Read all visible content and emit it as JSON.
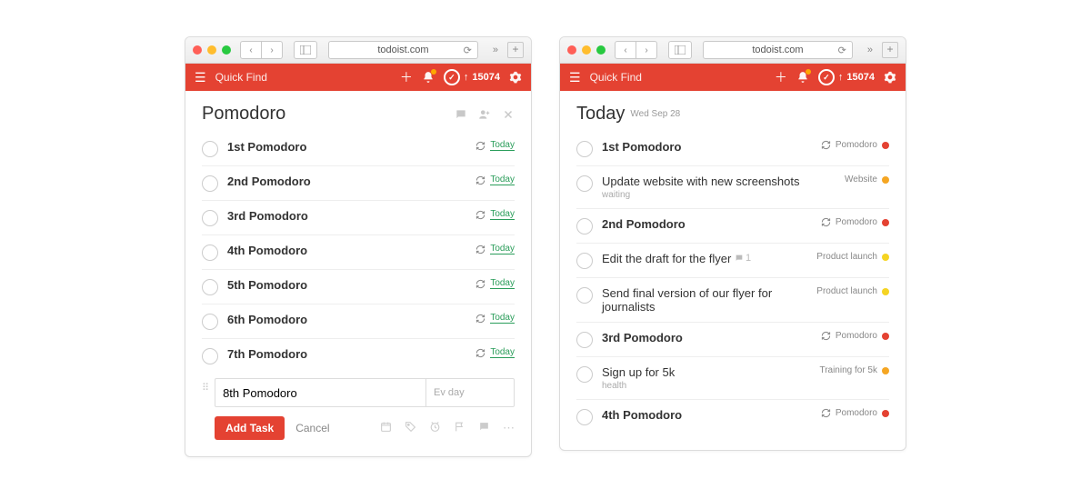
{
  "browser": {
    "url": "todoist.com"
  },
  "appbar": {
    "quick_find": "Quick Find",
    "karma_score": "15074"
  },
  "left": {
    "title": "Pomodoro",
    "tasks": [
      {
        "title": "1st Pomodoro",
        "tag": "Today",
        "recur": true
      },
      {
        "title": "2nd Pomodoro",
        "tag": "Today",
        "recur": true
      },
      {
        "title": "3rd Pomodoro",
        "tag": "Today",
        "recur": true
      },
      {
        "title": "4th Pomodoro",
        "tag": "Today",
        "recur": true
      },
      {
        "title": "5th Pomodoro",
        "tag": "Today",
        "recur": true
      },
      {
        "title": "6th Pomodoro",
        "tag": "Today",
        "recur": true
      },
      {
        "title": "7th Pomodoro",
        "tag": "Today",
        "recur": true
      }
    ],
    "new_task_value": "8th Pomodoro",
    "schedule_placeholder": "Ev day",
    "add_button": "Add Task",
    "cancel_button": "Cancel"
  },
  "right": {
    "title": "Today",
    "date": "Wed Sep 28",
    "tasks": [
      {
        "title": "1st Pomodoro",
        "project": "Pomodoro",
        "color": "#e44232",
        "recur": true,
        "bold": true
      },
      {
        "title": "Update website with new screenshots",
        "sub": "waiting",
        "project": "Website",
        "color": "#f5a623",
        "recur": false,
        "bold": false
      },
      {
        "title": "2nd Pomodoro",
        "project": "Pomodoro",
        "color": "#e44232",
        "recur": true,
        "bold": true
      },
      {
        "title": "Edit the draft for the flyer",
        "project": "Product launch",
        "color": "#f5d423",
        "recur": false,
        "bold": false,
        "comments": "1"
      },
      {
        "title": "Send final version of our flyer for journalists",
        "project": "Product launch",
        "color": "#f5d423",
        "recur": false,
        "bold": false
      },
      {
        "title": "3rd Pomodoro",
        "project": "Pomodoro",
        "color": "#e44232",
        "recur": true,
        "bold": true
      },
      {
        "title": "Sign up for 5k",
        "sub": "health",
        "project": "Training for 5k",
        "color": "#f5a623",
        "recur": false,
        "bold": false
      },
      {
        "title": "4th Pomodoro",
        "project": "Pomodoro",
        "color": "#e44232",
        "recur": true,
        "bold": true
      }
    ]
  }
}
